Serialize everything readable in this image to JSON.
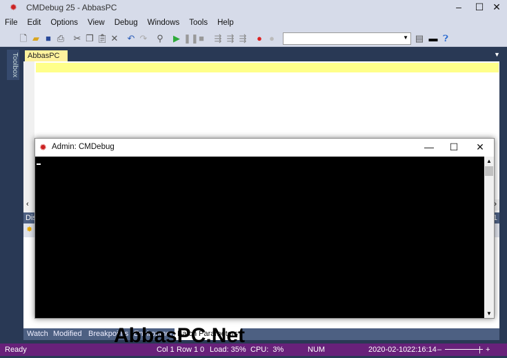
{
  "window": {
    "title": "CMDebug 25 - AbbasPC",
    "minimize": "–",
    "maximize": "☐",
    "close": "✕"
  },
  "menu": [
    "File",
    "Edit",
    "Options",
    "View",
    "Debug",
    "Windows",
    "Tools",
    "Help"
  ],
  "toolbar": {
    "icons": [
      "new-file-icon",
      "open-folder-icon",
      "save-icon",
      "print-icon",
      "cut-icon",
      "copy-icon",
      "paste-icon",
      "delete-icon",
      "undo-icon",
      "redo-icon",
      "find-icon",
      "run-icon",
      "pause-icon",
      "stop-icon",
      "step-into-icon",
      "step-over-icon",
      "step-out-icon",
      "breakpoint-icon",
      "clear-breakpoint-icon",
      "properties-icon",
      "console-icon",
      "help-icon"
    ],
    "combo_value": ""
  },
  "sidebar": {
    "toolbox": "Toolbox"
  },
  "document_tab": {
    "label": "AbbasPC",
    "close": "✕"
  },
  "panel": {
    "header": "Dis",
    "right_label": "1"
  },
  "bottom_tabs": [
    "Watch",
    "Modified",
    "Breakpoints",
    "Environment",
    "Batch Parameters"
  ],
  "console": {
    "title": "Admin: CMDebug",
    "minimize": "—",
    "maximize": "☐",
    "close": "✕"
  },
  "status": {
    "ready": "Ready",
    "col": "Col 1",
    "row": "Row 1",
    "zero": "0",
    "load": "Load: 35%",
    "cpu": "CPU:  3%",
    "num": "NUM",
    "date": "2020-02-10",
    "time": "22:16:14"
  },
  "colors": {
    "chrome": "#d6dbe9",
    "background": "#293955",
    "status": "#68217a",
    "doc_tab": "#fff29d"
  },
  "watermark": "AbbasPC.Net"
}
